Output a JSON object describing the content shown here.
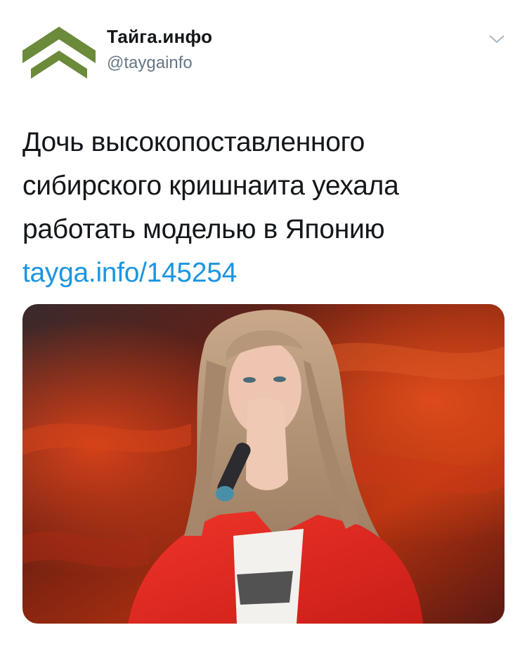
{
  "account": {
    "name": "Тайга.инфо",
    "handle": "@taygainfo",
    "avatar_icon": "taiga-chevron-logo",
    "menu_icon": "chevron-down-icon"
  },
  "tweet": {
    "lines": [
      "Дочь высокопоставленного",
      "сибирского кришнаита уехала",
      "работать моделью в Японию"
    ],
    "link": "tayga.info/145254"
  },
  "media": {
    "type": "photo"
  },
  "colors": {
    "logo_green": "#6b8a3a",
    "link_blue": "#1b95e0",
    "handle_gray": "#657786",
    "jacket_red": "#e3241c"
  }
}
